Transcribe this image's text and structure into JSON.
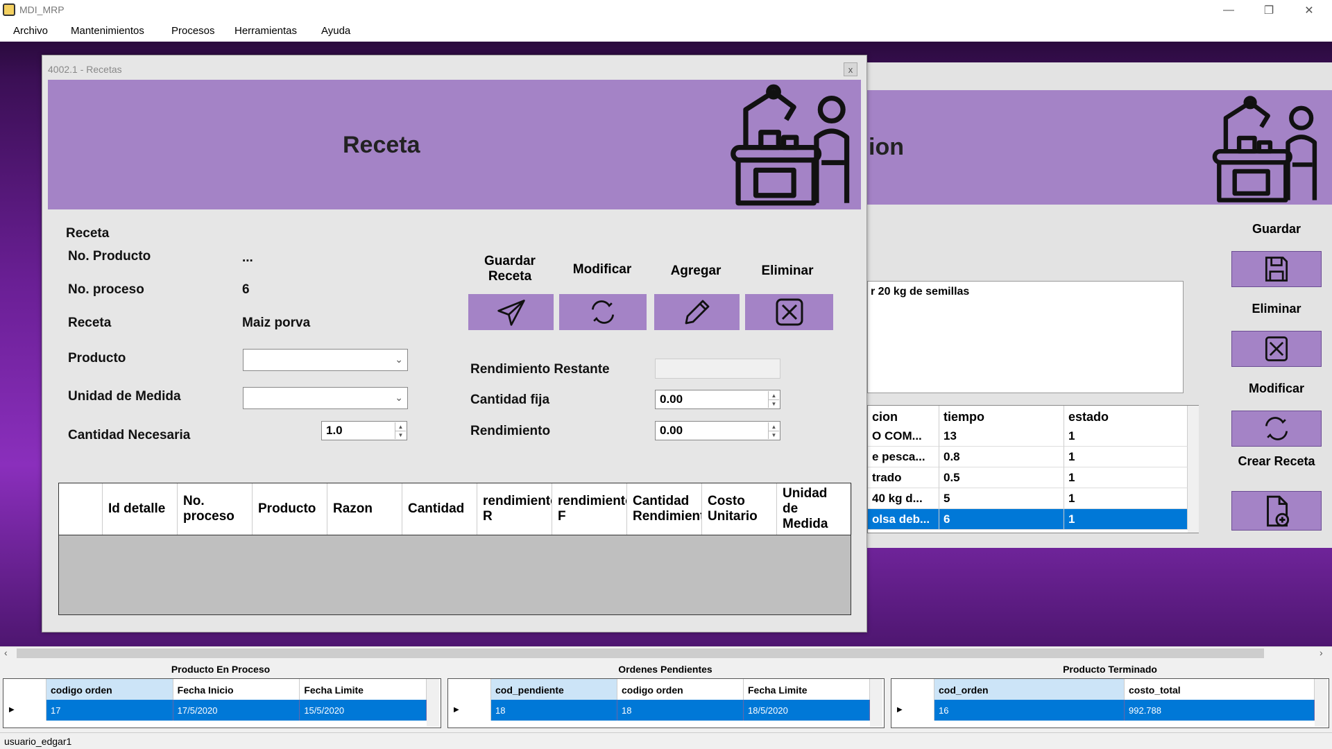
{
  "app": {
    "title": "MDI_MRP"
  },
  "menu": [
    "Archivo",
    "Mantenimientos",
    "Procesos",
    "Herramientas",
    "Ayuda"
  ],
  "bg_window": {
    "title_partial": "ion",
    "buttons": {
      "save": "Guardar",
      "delete": "Eliminar",
      "modify": "Modificar",
      "create_recipe": "Crear Receta"
    },
    "description": "r 20 kg de semillas",
    "grid": {
      "columns": [
        "cion",
        "tiempo",
        "estado"
      ],
      "rows": [
        [
          "O COM...",
          "13",
          "1"
        ],
        [
          "e pesca...",
          "0.8",
          "1"
        ],
        [
          "trado",
          "0.5",
          "1"
        ],
        [
          "40 kg d...",
          "5",
          "1"
        ],
        [
          "olsa deb...",
          "6",
          "1"
        ]
      ]
    }
  },
  "form": {
    "title": "4002.1 - Recetas",
    "close": "x",
    "banner_title": "Receta",
    "section_label": "Receta",
    "fields": {
      "no_producto": {
        "label": "No. Producto",
        "value": "..."
      },
      "no_proceso": {
        "label": "No. proceso",
        "value": "6"
      },
      "receta": {
        "label": "Receta",
        "value": "Maiz porva"
      },
      "producto": {
        "label": "Producto",
        "value": ""
      },
      "unidad": {
        "label": "Unidad de Medida",
        "value": ""
      },
      "cantidad_necesaria": {
        "label": "Cantidad Necesaria",
        "value": "1.0"
      },
      "rendimiento_restante": {
        "label": "Rendimiento Restante",
        "value": ""
      },
      "cantidad_fija": {
        "label": "Cantidad fija",
        "value": "0.00"
      },
      "rendimiento": {
        "label": "Rendimiento",
        "value": "0.00"
      }
    },
    "actions": {
      "save": "Guardar Receta",
      "modify": "Modificar",
      "add": "Agregar",
      "delete": "Eliminar"
    },
    "detail_columns": [
      "Id detalle",
      "No. proceso",
      "Producto",
      "Razon",
      "Cantidad",
      "rendimiento R",
      "rendimiento F",
      "Cantidad Rendimiento",
      "Costo Unitario",
      "Unidad de Medida"
    ]
  },
  "bottom": {
    "in_process": {
      "title": "Producto En Proceso",
      "columns": [
        "codigo orden",
        "Fecha Inicio",
        "Fecha Limite"
      ],
      "row": [
        "17",
        "17/5/2020",
        "15/5/2020"
      ]
    },
    "pending": {
      "title": "Ordenes Pendientes",
      "columns": [
        "cod_pendiente",
        "codigo orden",
        "Fecha Limite"
      ],
      "row": [
        "18",
        "18",
        "18/5/2020"
      ]
    },
    "finished": {
      "title": "Producto Terminado",
      "columns": [
        "cod_orden",
        "costo_total"
      ],
      "row": [
        "16",
        "992.788"
      ]
    }
  },
  "status": {
    "user": "usuario_edgar1"
  },
  "colors": {
    "banner": "#a483c6",
    "selection": "#0078d7"
  }
}
